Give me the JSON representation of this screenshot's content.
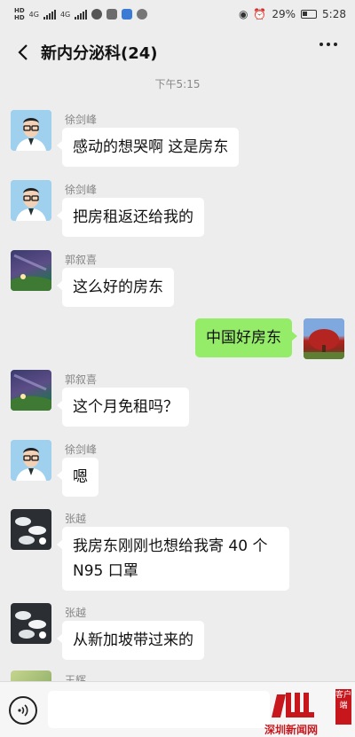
{
  "status_bar": {
    "battery": "29%",
    "time": "5:28",
    "carrier_labels": [
      "HD",
      "HD"
    ],
    "network": [
      "4G",
      "4G"
    ]
  },
  "header": {
    "title": "新内分泌科(24)"
  },
  "timestamp": "下午5:15",
  "messages": [
    {
      "sender": "徐剑峰",
      "text": "感动的想哭啊  这是房东",
      "avatar": "man-glasses"
    },
    {
      "sender": "徐剑峰",
      "text": "把房租返还给我的",
      "avatar": "man-glasses"
    },
    {
      "sender": "郭叙喜",
      "text": "这么好的房东",
      "avatar": "night-sky"
    },
    {
      "sender": "",
      "text": "中国好房东",
      "avatar": "red-tree",
      "mine": true
    },
    {
      "sender": "郭叙喜",
      "text": "这个月免租吗？",
      "avatar": "night-sky"
    },
    {
      "sender": "徐剑峰",
      "text": "嗯",
      "avatar": "man-glasses"
    },
    {
      "sender": "张越",
      "text_line1": "我房东刚刚也想给我寄 40 个",
      "text_line2": "N95 口罩",
      "avatar": "masks"
    },
    {
      "sender": "张越",
      "text": "从新加坡带过来的",
      "avatar": "masks"
    },
    {
      "sender": "王辉",
      "avatar": "plant"
    }
  ],
  "watermark": {
    "brand": "深圳新闻网",
    "side_text": "客户端"
  },
  "colors": {
    "my_bubble": "#95ec69",
    "background": "#ededed",
    "brand_red": "#c8161d"
  },
  "icons": [
    "back-arrow-icon",
    "more-dots-icon",
    "voice-icon"
  ]
}
